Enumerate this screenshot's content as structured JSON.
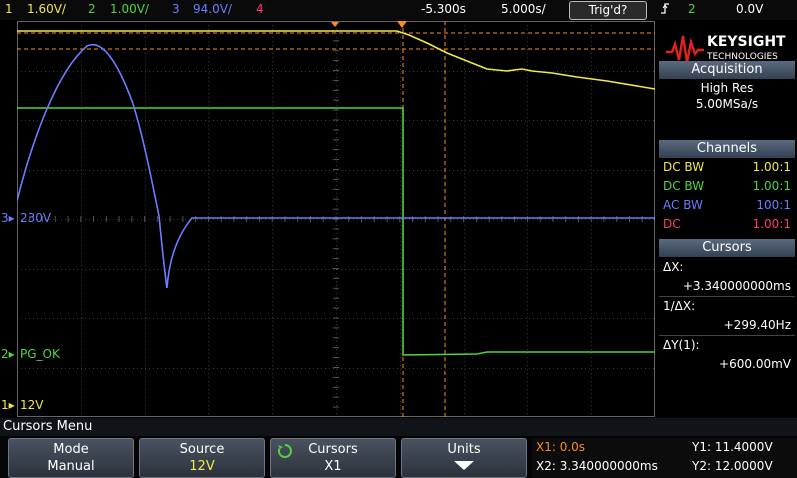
{
  "topbar": {
    "ch1_num": "1",
    "ch1_scale": "1.60V/",
    "ch2_num": "2",
    "ch2_scale": "1.00V/",
    "ch3_num": "3",
    "ch3_scale": "94.0V/",
    "ch4_num": "4",
    "time_offset": "-5.300s",
    "time_scale": "5.000s/",
    "trig_status": "Trig'd?",
    "trig_icon": "edge-rise-icon",
    "trig_source": "2",
    "trig_level": "0.0V"
  },
  "markers": {
    "ch3_label": "3",
    "ch3_text": "230V",
    "ch2_label": "2",
    "ch2_text": "PG_OK",
    "ch1_label": "1",
    "ch1_text": "12V"
  },
  "panel": {
    "brand": "KEYSIGHT",
    "brand_sub": "TECHNOLOGIES",
    "acquisition_title": "Acquisition",
    "acq_mode": "High Res",
    "acq_rate": "5.00MSa/s",
    "channels_title": "Channels",
    "channels": [
      {
        "coupling": "DC BW",
        "ratio": "1.00:1"
      },
      {
        "coupling": "DC BW",
        "ratio": "1.00:1"
      },
      {
        "coupling": "AC BW",
        "ratio": "100:1"
      },
      {
        "coupling": "DC",
        "ratio": "1.00:1"
      }
    ],
    "cursors_title": "Cursors",
    "dx_label": "ΔX:",
    "dx_value": "+3.340000000ms",
    "inv_dx_label": "1/ΔX:",
    "inv_dx_value": "+299.40Hz",
    "dy_label": "ΔY(1):",
    "dy_value": "+600.00mV"
  },
  "menu": {
    "title": "Cursors Menu",
    "keys": [
      {
        "label": "Mode",
        "value": "Manual"
      },
      {
        "label": "Source",
        "value": "12V"
      },
      {
        "label": "Cursors",
        "value": "X1"
      },
      {
        "label": "Units",
        "value": ""
      }
    ]
  },
  "cursor_info": {
    "x1": "X1: 0.0s",
    "x2": "X2: 3.340000000ms",
    "y1": "Y1: 11.4000V",
    "y2": "Y2: 12.0000V"
  },
  "colors": {
    "ch1": "#f2e84a",
    "ch2": "#4fd63a",
    "ch3": "#6c7dff",
    "ch4": "#ff3b6e",
    "cursor": "#ff8c1a"
  }
}
